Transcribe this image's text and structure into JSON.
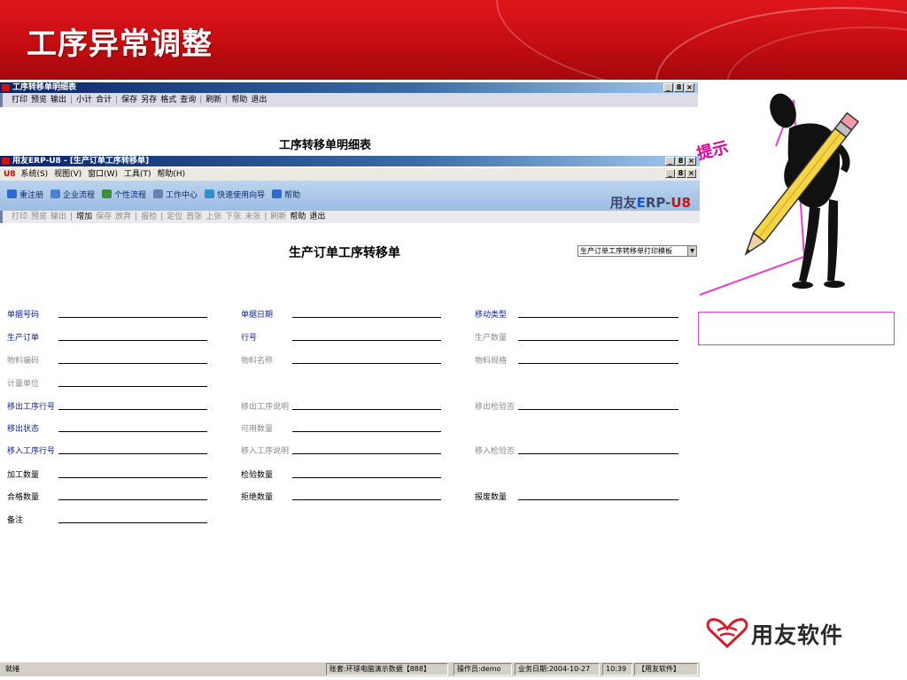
{
  "slide": {
    "title": "工序异常调整"
  },
  "report_window": {
    "title": "工序转移单明细表",
    "win_buttons": [
      "_",
      "8",
      "×"
    ],
    "toolbar": [
      "打印",
      "预览",
      "输出",
      "|",
      "小计",
      "合计",
      "|",
      "保存",
      "另存",
      "格式",
      "查询",
      "|",
      "刷新",
      "|",
      "帮助",
      "退出"
    ],
    "report_title": "工序转移单明细表"
  },
  "erp_window": {
    "title": "用友ERP-U8 - [生产订单工序转移单]",
    "logo": "U8",
    "menu": [
      "系统(S)",
      "视图(V)",
      "窗口(W)",
      "工具(T)",
      "帮助(H)"
    ],
    "nav": [
      {
        "label": "重注册",
        "icon": "register-icon",
        "color": "#2d6bd0"
      },
      {
        "label": "企业流程",
        "icon": "org-flow-icon",
        "color": "#4a7fd6"
      },
      {
        "label": "个性流程",
        "icon": "personal-flow-icon",
        "color": "#3b8f3b"
      },
      {
        "label": "工作中心",
        "icon": "work-center-icon",
        "color": "#6a7fb6"
      },
      {
        "label": "快速使用向导",
        "icon": "wizard-icon",
        "color": "#2d8fd0"
      },
      {
        "label": "帮助",
        "icon": "help-icon",
        "color": "#2d6bd0"
      }
    ],
    "brand": {
      "prefix": "用友",
      "e": "E",
      "rp": "RP",
      "dash": "-",
      "u": "U8"
    },
    "toolbar": [
      {
        "label": "打印",
        "state": "dim"
      },
      {
        "label": "预览",
        "state": "dim"
      },
      {
        "label": "输出",
        "state": "dim"
      },
      {
        "label": "|",
        "state": "sep"
      },
      {
        "label": "增加",
        "state": "active"
      },
      {
        "label": "保存",
        "state": "dim"
      },
      {
        "label": "放弃",
        "state": "dim"
      },
      {
        "label": "|",
        "state": "sep"
      },
      {
        "label": "报检",
        "state": "dim"
      },
      {
        "label": "|",
        "state": "sep"
      },
      {
        "label": "定位",
        "state": "dim"
      },
      {
        "label": "首张",
        "state": "dim"
      },
      {
        "label": "上张",
        "state": "dim"
      },
      {
        "label": "下张",
        "state": "dim"
      },
      {
        "label": "末张",
        "state": "dim"
      },
      {
        "label": "|",
        "state": "sep"
      },
      {
        "label": "刷新",
        "state": "dim"
      },
      {
        "label": "帮助",
        "state": "active"
      },
      {
        "label": "退出",
        "state": "active"
      }
    ]
  },
  "form": {
    "title": "生产订单工序转移单",
    "print_template": "生产订单工序转移单打印模板",
    "rows": [
      [
        {
          "label": "单据号码",
          "style": "blue"
        },
        {
          "label": "单据日期",
          "style": "blue"
        },
        {
          "label": "移动类型",
          "style": "blue"
        }
      ],
      [
        {
          "label": "生产订单",
          "style": "blue"
        },
        {
          "label": "行号",
          "style": "blue"
        },
        {
          "label": "生产数量",
          "style": "gray"
        }
      ],
      [
        {
          "label": "物料编码",
          "style": "gray"
        },
        {
          "label": "物料名称",
          "style": "gray"
        },
        {
          "label": "物料规格",
          "style": "gray"
        }
      ],
      [
        {
          "label": "计量单位",
          "style": "gray"
        },
        null,
        null
      ],
      [
        {
          "label": "移出工序行号",
          "style": "blue"
        },
        {
          "label": "移出工序说明",
          "style": "gray"
        },
        {
          "label": "移出检验否",
          "style": "gray"
        }
      ],
      [
        {
          "label": "移出状态",
          "style": "blue"
        },
        {
          "label": "可用数量",
          "style": "gray"
        },
        null
      ],
      [
        {
          "label": "移入工序行号",
          "style": "blue"
        },
        {
          "label": "移入工序说明",
          "style": "gray"
        },
        {
          "label": "移入检验否",
          "style": "gray"
        }
      ],
      [
        {
          "label": "加工数量",
          "style": "black"
        },
        {
          "label": "检验数量",
          "style": "black"
        },
        null
      ],
      [
        {
          "label": "合格数量",
          "style": "black"
        },
        {
          "label": "拒绝数量",
          "style": "black"
        },
        {
          "label": "报废数量",
          "style": "black"
        }
      ],
      [
        {
          "label": "备注",
          "style": "black"
        },
        null,
        null
      ]
    ]
  },
  "statusbar": {
    "ready": "就绪",
    "account": "账套:环球电脑演示数据【888】",
    "operator": "操作员:demo",
    "business_date": "业务日期:2004-10-27",
    "time": "10:39",
    "company": "【用友软件】"
  },
  "tip": {
    "text": "提示"
  },
  "brand": {
    "name": "用友软件",
    "icon": "yonyou-logo-icon"
  },
  "colors": {
    "banner_red": "#c40d12",
    "label_blue": "#12238f",
    "tip_magenta": "#e0009a"
  }
}
